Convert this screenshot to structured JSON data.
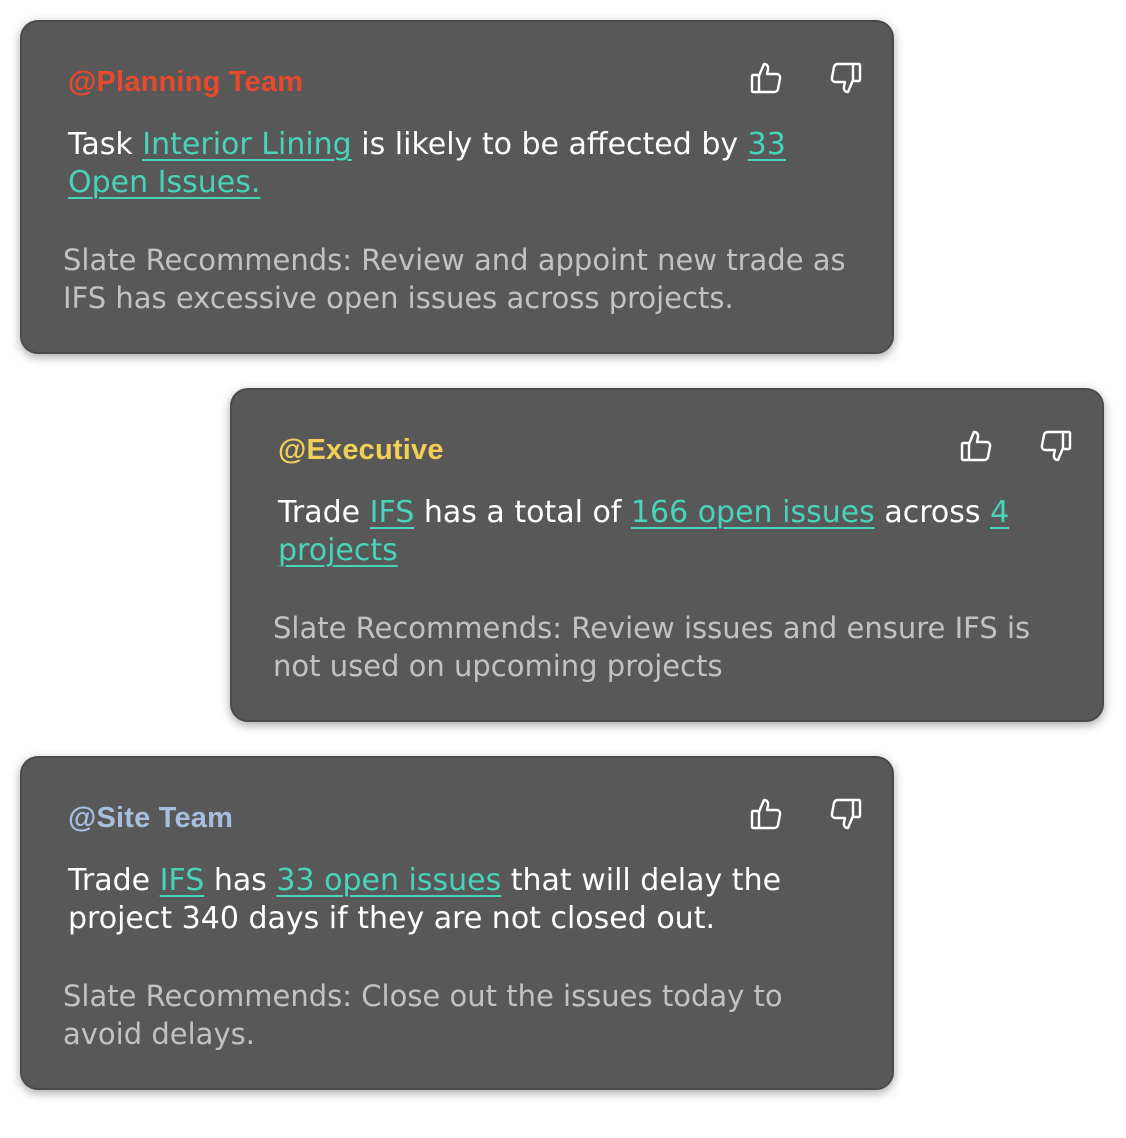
{
  "colors": {
    "card_background": "#585858",
    "link": "#47d4b8",
    "message_text": "#ffffff",
    "recommendation_text": "#c2c2c2",
    "icon": "#ffffff"
  },
  "cards": [
    {
      "mention": "@Planning Team",
      "mention_color": "#e64a2c",
      "icons": {
        "like": "thumbs-up-icon",
        "dislike": "thumbs-down-icon"
      },
      "message": {
        "p1": "Task ",
        "link1": "Interior Lining",
        "p2": " is likely to be affected by ",
        "link2": "33 Open Issues."
      },
      "recommendation": "Slate Recommends: Review and appoint new trade as IFS has excessive open issues across projects."
    },
    {
      "mention": "@Executive",
      "mention_color": "#f2d057",
      "icons": {
        "like": "thumbs-up-icon",
        "dislike": "thumbs-down-icon"
      },
      "message": {
        "p1": "Trade ",
        "link1": "IFS",
        "p2": " has a total of ",
        "link2": "166 open issues",
        "p3": " across ",
        "link3": "4 projects"
      },
      "recommendation": "Slate Recommends: Review issues and ensure IFS is not used on upcoming projects"
    },
    {
      "mention": "@Site Team",
      "mention_color": "#a8bedf",
      "icons": {
        "like": "thumbs-up-icon",
        "dislike": "thumbs-down-icon"
      },
      "message": {
        "p1": "Trade ",
        "link1": "IFS",
        "p2": " has ",
        "link2": "33 open issues",
        "p3": " that will delay the project 340 days if they are not closed out."
      },
      "recommendation": "Slate Recommends: Close out the issues today to avoid delays."
    }
  ]
}
